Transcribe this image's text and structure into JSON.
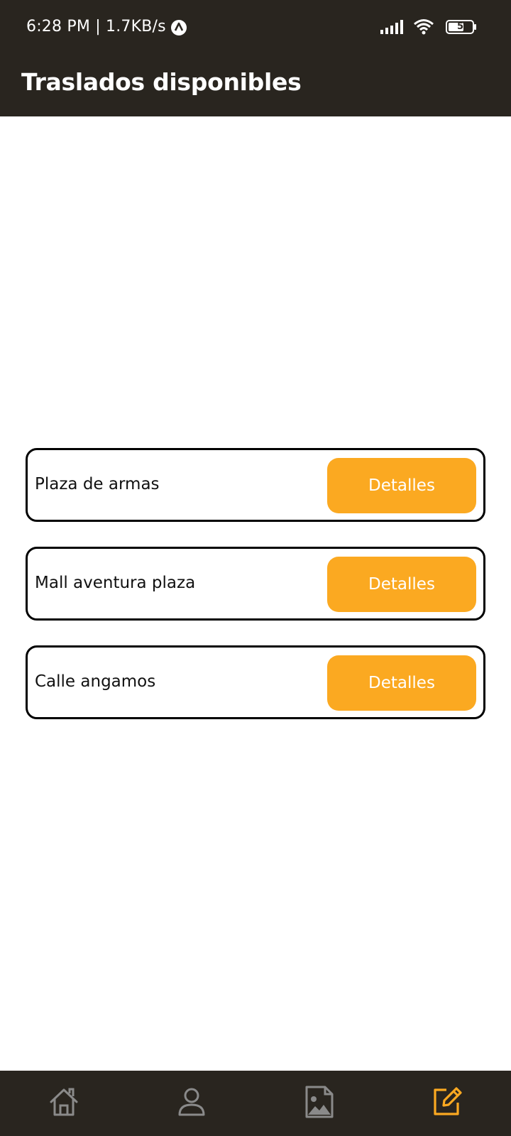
{
  "status_bar": {
    "time": "6:28 PM | 1.7KB/s",
    "battery": "58",
    "icons": [
      "app-notification-icon",
      "signal-icon",
      "wifi-icon",
      "battery-icon"
    ]
  },
  "app_bar": {
    "title": "Traslados disponibles"
  },
  "transfers": [
    {
      "name": "Plaza de armas",
      "button_label": "Detalles"
    },
    {
      "name": "Mall aventura plaza",
      "button_label": "Detalles"
    },
    {
      "name": "Calle angamos",
      "button_label": "Detalles"
    }
  ],
  "bottom_nav": {
    "items": [
      {
        "icon": "home-icon",
        "active": false
      },
      {
        "icon": "profile-icon",
        "active": false
      },
      {
        "icon": "image-icon",
        "active": false
      },
      {
        "icon": "edit-icon",
        "active": true
      }
    ]
  },
  "colors": {
    "bar_background": "#29251f",
    "accent": "#fba921",
    "inactive_icon": "#8a8a8a"
  }
}
